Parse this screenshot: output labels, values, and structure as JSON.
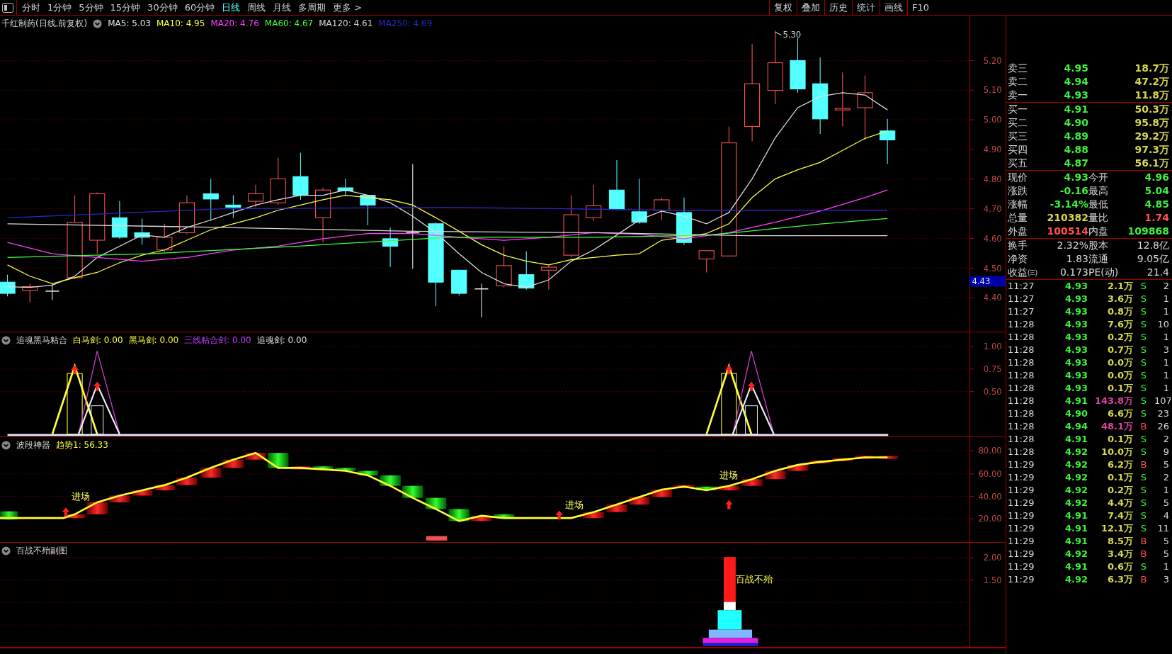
{
  "toolbar": {
    "periods": [
      {
        "label": "分时",
        "selected": false
      },
      {
        "label": "1分钟",
        "selected": false
      },
      {
        "label": "5分钟",
        "selected": false
      },
      {
        "label": "15分钟",
        "selected": false
      },
      {
        "label": "30分钟",
        "selected": false
      },
      {
        "label": "60分钟",
        "selected": false
      },
      {
        "label": "日线",
        "selected": true
      },
      {
        "label": "周线",
        "selected": false
      },
      {
        "label": "月线",
        "selected": false
      },
      {
        "label": "多周期",
        "selected": false
      },
      {
        "label": "更多 >",
        "selected": false
      }
    ],
    "actions": [
      "复权",
      "叠加",
      "历史",
      "统计",
      "画线",
      "F10"
    ]
  },
  "main_chart": {
    "title": "千红制药(日线,前复权)",
    "indicators": [
      {
        "label": "MA5: 5.03",
        "color": "#e0e0e0"
      },
      {
        "label": "MA10: 4.95",
        "color": "#ffff40"
      },
      {
        "label": "MA20: 4.76",
        "color": "#ff40ff"
      },
      {
        "label": "MA60: 4.67",
        "color": "#40ff40"
      },
      {
        "label": "MA120: 4.61",
        "color": "#d8d8d8"
      },
      {
        "label": "MA250: 4.69",
        "color": "#2828c8"
      }
    ],
    "price_axis": [
      "5.20",
      "5.10",
      "5.00",
      "4.90",
      "4.80",
      "4.70",
      "4.60",
      "4.50",
      "4.40"
    ],
    "high_marker": "5.30",
    "current_price_tag": "4.43"
  },
  "indicator_1": {
    "title": "追魂黑马粘合",
    "values": [
      {
        "label": "白马剑: 0.00",
        "color": "#ffff40"
      },
      {
        "label": "黑马剑: 0.00",
        "color": "#ffff40"
      },
      {
        "label": "三线粘合剑: 0.00",
        "color": "#c040ff"
      },
      {
        "label": "追魂剑: 0.00",
        "color": "#e0e0e0"
      }
    ],
    "axis": [
      "1.00",
      "0.75",
      "0.50"
    ]
  },
  "indicator_2": {
    "title": "波段神器",
    "values": [
      {
        "label": "趋势1: 56.33",
        "color": "#ffff40"
      }
    ],
    "axis": [
      "80.00",
      "60.00",
      "40.00",
      "20.00"
    ],
    "signals": [
      "进场",
      "进场",
      "进场"
    ]
  },
  "indicator_3": {
    "title": "百战不殆副图",
    "axis": [
      "2.00",
      "1.50"
    ],
    "signal": "百战不殆"
  },
  "quote": {
    "asks": [
      {
        "label": "卖三",
        "price": "4.95",
        "volume": "18.7万"
      },
      {
        "label": "卖二",
        "price": "4.94",
        "volume": "47.2万"
      },
      {
        "label": "卖一",
        "price": "4.93",
        "volume": "11.8万"
      }
    ],
    "bids": [
      {
        "label": "买一",
        "price": "4.91",
        "volume": "50.3万"
      },
      {
        "label": "买二",
        "price": "4.90",
        "volume": "95.8万"
      },
      {
        "label": "买三",
        "price": "4.89",
        "volume": "29.2万"
      },
      {
        "label": "买四",
        "price": "4.88",
        "volume": "97.3万"
      },
      {
        "label": "买五",
        "price": "4.87",
        "volume": "56.1万"
      }
    ],
    "stats": [
      [
        {
          "label": "现价",
          "value": "4.93",
          "kind": "down"
        },
        {
          "label": "今开",
          "value": "4.96",
          "kind": "down"
        }
      ],
      [
        {
          "label": "涨跌",
          "value": "-0.16",
          "kind": "down"
        },
        {
          "label": "最高",
          "value": "5.04",
          "kind": "down"
        }
      ],
      [
        {
          "label": "涨幅",
          "value": "-3.14%",
          "kind": "down"
        },
        {
          "label": "最低",
          "value": "4.85",
          "kind": "down"
        }
      ],
      [
        {
          "label": "总量",
          "value": "210382",
          "kind": "volume"
        },
        {
          "label": "量比",
          "value": "1.74",
          "kind": "up"
        }
      ],
      [
        {
          "label": "外盘",
          "value": "100514",
          "kind": "up"
        },
        {
          "label": "内盘",
          "value": "109868",
          "kind": "down"
        }
      ]
    ],
    "finance": [
      [
        {
          "label": "换手",
          "value": "2.32%"
        },
        {
          "label": "股本",
          "value": "12.8亿"
        }
      ],
      [
        {
          "label": "净资",
          "value": "1.83"
        },
        {
          "label": "流通",
          "value": "9.05亿"
        }
      ],
      [
        {
          "label": "收益㈢",
          "value": "0.173"
        },
        {
          "label": "PE(动)",
          "value": "21.4"
        }
      ]
    ],
    "ticks": [
      {
        "time": "11:27",
        "price": "4.93",
        "volume": "2.1万",
        "large": false,
        "side": "S",
        "kind": "sell",
        "count": "2"
      },
      {
        "time": "11:27",
        "price": "4.93",
        "volume": "3.6万",
        "large": false,
        "side": "S",
        "kind": "sell",
        "count": "1"
      },
      {
        "time": "11:27",
        "price": "4.93",
        "volume": "0.8万",
        "large": false,
        "side": "S",
        "kind": "sell",
        "count": "1"
      },
      {
        "time": "11:28",
        "price": "4.93",
        "volume": "7.6万",
        "large": false,
        "side": "S",
        "kind": "sell",
        "count": "10"
      },
      {
        "time": "11:28",
        "price": "4.93",
        "volume": "0.2万",
        "large": false,
        "side": "S",
        "kind": "sell",
        "count": "1"
      },
      {
        "time": "11:28",
        "price": "4.93",
        "volume": "0.7万",
        "large": false,
        "side": "S",
        "kind": "sell",
        "count": "3"
      },
      {
        "time": "11:28",
        "price": "4.93",
        "volume": "0.0万",
        "large": false,
        "side": "S",
        "kind": "sell",
        "count": "1"
      },
      {
        "time": "11:28",
        "price": "4.93",
        "volume": "0.0万",
        "large": false,
        "side": "S",
        "kind": "sell",
        "count": "1"
      },
      {
        "time": "11:28",
        "price": "4.93",
        "volume": "0.1万",
        "large": false,
        "side": "S",
        "kind": "sell",
        "count": "1"
      },
      {
        "time": "11:28",
        "price": "4.91",
        "volume": "143.8万",
        "large": true,
        "side": "S",
        "kind": "sell",
        "count": "107"
      },
      {
        "time": "11:28",
        "price": "4.90",
        "volume": "6.6万",
        "large": false,
        "side": "S",
        "kind": "sell",
        "count": "23"
      },
      {
        "time": "11:28",
        "price": "4.94",
        "volume": "48.1万",
        "large": true,
        "side": "B",
        "kind": "buy",
        "count": "26"
      },
      {
        "time": "11:28",
        "price": "4.91",
        "volume": "0.1万",
        "large": false,
        "side": "S",
        "kind": "sell",
        "count": "2"
      },
      {
        "time": "11:28",
        "price": "4.92",
        "volume": "10.0万",
        "large": false,
        "side": "S",
        "kind": "sell",
        "count": "9"
      },
      {
        "time": "11:29",
        "price": "4.92",
        "volume": "6.2万",
        "large": false,
        "side": "B",
        "kind": "buy",
        "count": "5"
      },
      {
        "time": "11:29",
        "price": "4.92",
        "volume": "0.1万",
        "large": false,
        "side": "S",
        "kind": "sell",
        "count": "2"
      },
      {
        "time": "11:29",
        "price": "4.92",
        "volume": "0.2万",
        "large": false,
        "side": "S",
        "kind": "sell",
        "count": "1"
      },
      {
        "time": "11:29",
        "price": "4.92",
        "volume": "4.4万",
        "large": false,
        "side": "S",
        "kind": "sell",
        "count": "5"
      },
      {
        "time": "11:29",
        "price": "4.91",
        "volume": "7.4万",
        "large": false,
        "side": "S",
        "kind": "sell",
        "count": "4"
      },
      {
        "time": "11:29",
        "price": "4.91",
        "volume": "12.1万",
        "large": false,
        "side": "S",
        "kind": "sell",
        "count": "11"
      },
      {
        "time": "11:29",
        "price": "4.91",
        "volume": "8.5万",
        "large": false,
        "side": "B",
        "kind": "buy",
        "count": "5"
      },
      {
        "time": "11:29",
        "price": "4.92",
        "volume": "3.4万",
        "large": false,
        "side": "B",
        "kind": "buy",
        "count": "5"
      },
      {
        "time": "11:29",
        "price": "4.91",
        "volume": "0.6万",
        "large": false,
        "side": "S",
        "kind": "sell",
        "count": "1"
      },
      {
        "time": "11:29",
        "price": "4.92",
        "volume": "6.3万",
        "large": false,
        "side": "B",
        "kind": "buy",
        "count": "3"
      }
    ]
  }
}
